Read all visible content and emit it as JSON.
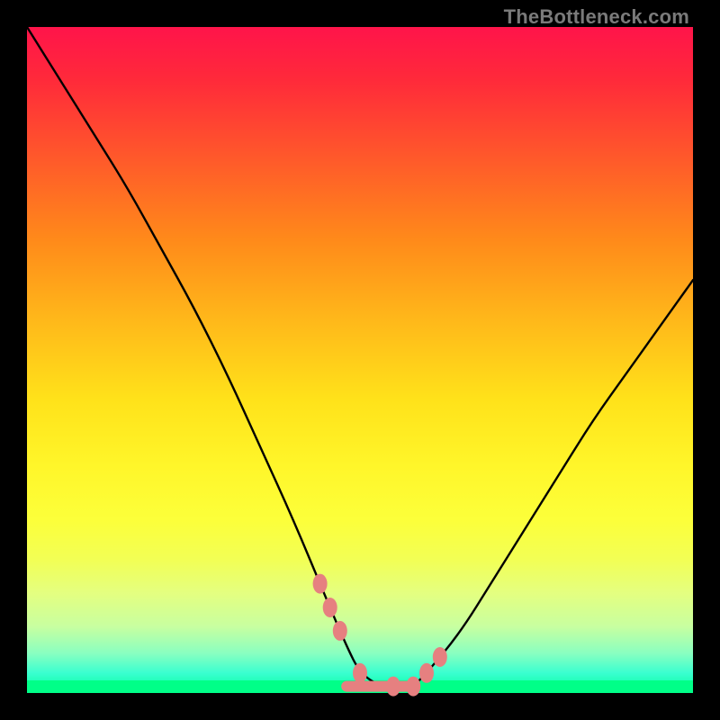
{
  "watermark": "TheBottleneck.com",
  "chart_data": {
    "type": "line",
    "title": "",
    "xlabel": "",
    "ylabel": "",
    "xlim": [
      0,
      100
    ],
    "ylim": [
      0,
      100
    ],
    "x": [
      0,
      5,
      10,
      15,
      20,
      25,
      30,
      35,
      40,
      45,
      48,
      50,
      53,
      55,
      58,
      60,
      65,
      70,
      75,
      80,
      85,
      90,
      95,
      100
    ],
    "values": [
      100,
      92,
      84,
      76,
      67,
      58,
      48,
      37,
      26,
      14,
      7,
      3,
      1,
      1,
      1,
      3,
      9,
      17,
      25,
      33,
      41,
      48,
      55,
      62
    ],
    "description": "V-shaped bottleneck curve with minimum near x≈53–58; left arm steeper than right; salmon markers and flat segment near minimum over rainbow heat gradient.",
    "annotations": {
      "marker_color": "#e68080",
      "marker_points_x": [
        44,
        45.5,
        47,
        50,
        55,
        58,
        60,
        62
      ],
      "flat_segment_x": [
        48,
        58
      ]
    }
  },
  "colors": {
    "frame": "#000000",
    "line": "#000000",
    "marker": "#e68080",
    "watermark": "#7a7a7a"
  }
}
